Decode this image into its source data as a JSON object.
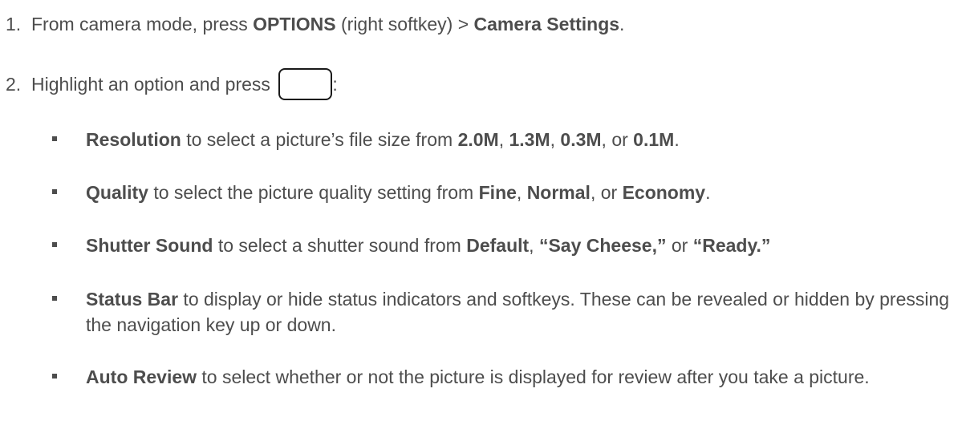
{
  "steps": [
    {
      "number": "1.",
      "parts": [
        "From camera mode, press ",
        "OPTIONS",
        " (right softkey) > ",
        "Camera Settings",
        "."
      ]
    },
    {
      "number": "2.",
      "parts": [
        "Highlight an option and press ",
        ":"
      ]
    }
  ],
  "bullets": [
    {
      "parts": [
        "Resolution",
        " to select a picture’s file size from ",
        "2.0M",
        ", ",
        "1.3M",
        ", ",
        "0.3M",
        ", or ",
        "0.1M",
        "."
      ]
    },
    {
      "parts": [
        "Quality",
        " to select the picture quality setting from ",
        "Fine",
        ", ",
        "Normal",
        ", or ",
        "Economy",
        "."
      ]
    },
    {
      "parts": [
        "Shutter Sound",
        " to select a shutter sound from ",
        "Default",
        ", ",
        "“Say Cheese,”",
        " or ",
        "“Ready.”"
      ]
    },
    {
      "parts": [
        "Status Bar",
        " to display or hide status indicators and softkeys. These can be revealed or hidden by pressing the navigation key up or down."
      ]
    },
    {
      "parts": [
        "Auto Review",
        " to select whether or not the picture is displayed for review after you take a picture."
      ]
    }
  ]
}
